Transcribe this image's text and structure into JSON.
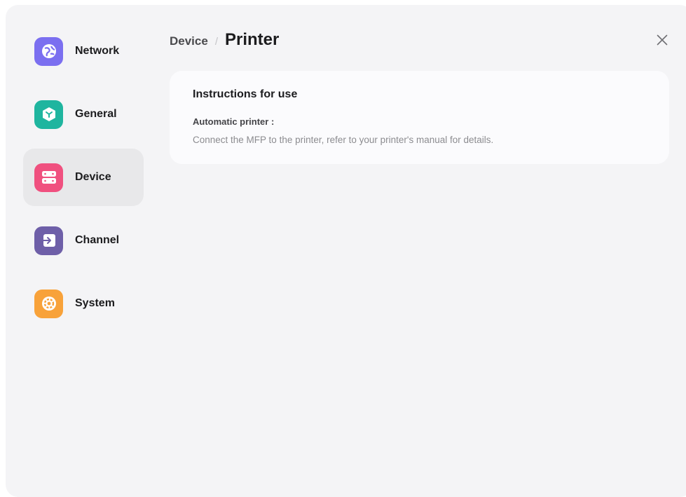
{
  "sidebar": {
    "items": [
      {
        "label": "Network",
        "icon": "globe-icon",
        "color": "#7b6ff0",
        "active": false
      },
      {
        "label": "General",
        "icon": "cube-icon",
        "color": "#1fb59f",
        "active": false
      },
      {
        "label": "Device",
        "icon": "server-icon",
        "color": "#f0507f",
        "active": true
      },
      {
        "label": "Channel",
        "icon": "input-arrow-icon",
        "color": "#6e5fa8",
        "active": false
      },
      {
        "label": "System",
        "icon": "gear-icon",
        "color": "#f8a23a",
        "active": false
      }
    ]
  },
  "header": {
    "breadcrumb_parent": "Device",
    "breadcrumb_separator": "/",
    "title": "Printer"
  },
  "card": {
    "title": "Instructions for use",
    "label": "Automatic printer :",
    "text": "Connect the MFP to the printer, refer to your printer's manual for details."
  },
  "colors": {
    "background": "#f4f4f6",
    "card": "#fbfbfd",
    "active_item": "#e8e8ea"
  }
}
